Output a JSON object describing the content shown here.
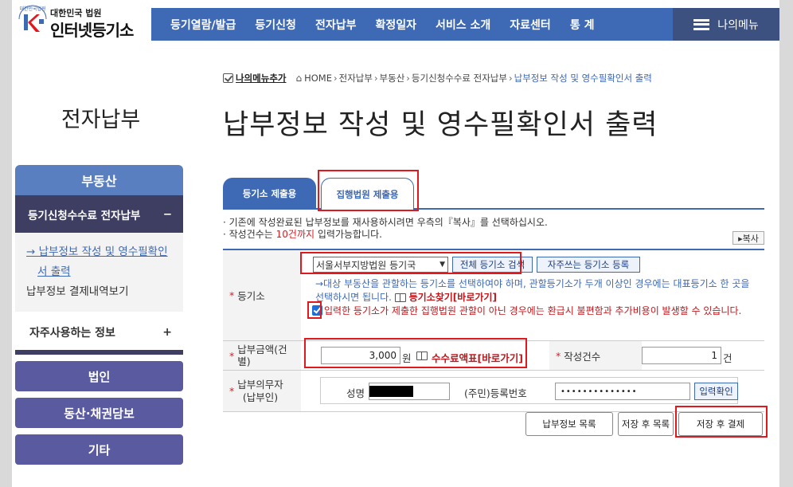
{
  "header": {
    "logo_small": "대한민국 법원",
    "logo_big": "인터넷등기소",
    "seal_text": "대한민국법원",
    "nav": [
      "등기열람/발급",
      "등기신청",
      "전자납부",
      "확정일자",
      "서비스 소개",
      "자료센터",
      "통 계"
    ],
    "my_menu": "나의메뉴"
  },
  "breadcrumb": {
    "add_label": "나의메뉴추가",
    "items": [
      "HOME",
      "전자납부",
      "부동산",
      "등기신청수수료 전자납부"
    ],
    "current": "납부정보 작성 및 영수필확인서 출력"
  },
  "section_title": "전자납부",
  "page_title": "납부정보 작성 및 영수필확인서 출력",
  "sidebar": {
    "head": "부동산",
    "sub": "등기신청수수료 전자납부",
    "sub_toggle": "−",
    "items": [
      {
        "label_l1": "→ 납부정보 작성 및 영수필확인",
        "label_l2": "서 출력"
      },
      {
        "label": "납부정보 결제내역보기"
      }
    ],
    "fav": "자주사용하는 정보",
    "fav_toggle": "+",
    "buttons": [
      "법인",
      "동산·채권담보",
      "기타"
    ]
  },
  "tabs": [
    "등기소 제출용",
    "집행법원 제출용"
  ],
  "notes": {
    "line1": "· 기존에 작성완료된 납부정보를 재사용하시려면 우측의『복사』를 선택하십시오.",
    "line2_pre": "· 작성건수는 ",
    "line2_red": "10건까지",
    "line2_post": " 입력가능합니다.",
    "copy_btn": "▸복사"
  },
  "form": {
    "registry": {
      "label": "등기소",
      "selected": "서울서부지방법원 등기국",
      "search_btn": "전체 등기소 검색",
      "fav_btn": "자주쓰는 등기소 등록",
      "guide": "→대상 부동산을 관할하는 등기소를 선택하여야 하며, 관할등기소가 두개 이상인 경우에는 대표등기소 한 곳을 선택하시면 됩니다.",
      "guide_link": "등기소찾기[바로가기]",
      "warn": "입력한 등기소가 제출한 집행법원 관할이 아닌 경우에는 환급시 불편함과 추가비용이 발생할 수 있습니다."
    },
    "amount": {
      "label_l1": "납부금액(건",
      "label_l2": "별)",
      "value": "3,000",
      "unit": "원",
      "fee_link": "수수료액표[바로가기]",
      "count_label": "작성건수",
      "count_value": "1",
      "count_unit": "건"
    },
    "payer": {
      "label_l1": "납부의무자",
      "label_l2": "(납부인)",
      "name_label": "성명",
      "id_label": "(주민)등록번호",
      "id_value": "••••••••••••••",
      "confirm_btn": "입력확인"
    },
    "star": "*"
  },
  "buttons": {
    "list": "납부정보 목록",
    "save_list": "저장 후 목록",
    "save_pay": "저장 후 결제"
  },
  "colors": {
    "accent": "#3e69b4",
    "highlight": "#e0191e",
    "nav_dark": "#3c5180"
  }
}
